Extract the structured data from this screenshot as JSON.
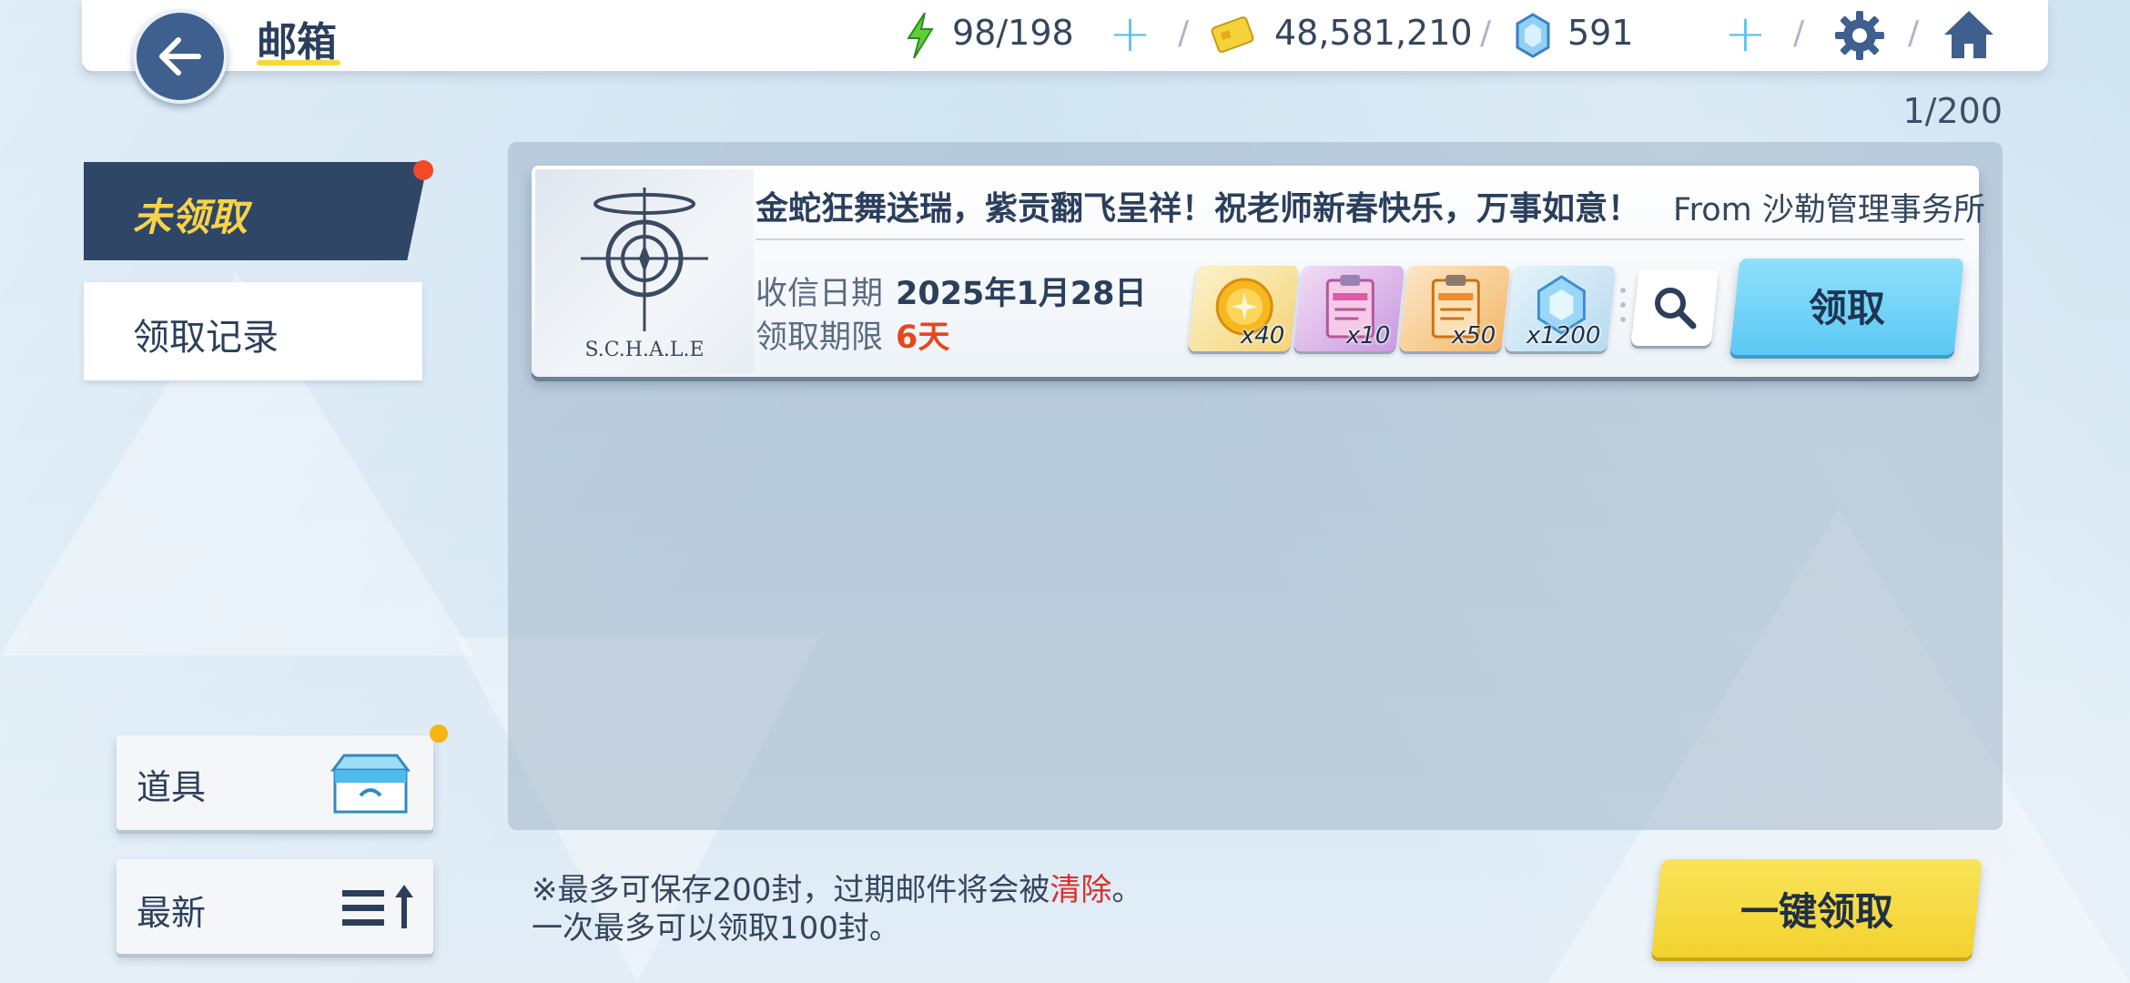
{
  "header": {
    "title": "邮箱",
    "stamina": "98/198",
    "credits": "48,581,210",
    "gems": "591",
    "stamina_add": "+",
    "gems_add": "+",
    "separators": [
      "/",
      "/",
      "/",
      "/",
      "/"
    ]
  },
  "page_counter": "1/200",
  "tabs": {
    "unclaimed": "未领取",
    "history": "领取记录"
  },
  "mail": {
    "logo_text": "S.C.H.A.L.E",
    "subject": "金蛇狂舞送瑞，紫贡翻飞呈祥！祝老师新春快乐，万事如意！",
    "from": "From 沙勒管理事务所",
    "received_label": "收信日期",
    "received_value": "2025年1月28日",
    "deadline_label": "领取期限",
    "deadline_value": "6天",
    "rewards": [
      {
        "icon": "gold-coin-icon",
        "qty": "x40"
      },
      {
        "icon": "pink-report-icon",
        "qty": "x10"
      },
      {
        "icon": "orange-report-icon",
        "qty": "x50"
      },
      {
        "icon": "blue-crystal-icon",
        "qty": "x1200"
      }
    ],
    "claim_label": "领取"
  },
  "bottom": {
    "items_label": "道具",
    "sort_label": "最新",
    "notice_line1_a": "※最多可保存200封，过期邮件将会被",
    "notice_line1_red": "清除",
    "notice_line1_b": "。",
    "notice_line2": "一次最多可以领取100封。",
    "claim_all_label": "一键领取"
  },
  "colors": {
    "accent_blue": "#5bc8f5",
    "accent_yellow": "#f2d22e",
    "navy": "#2f4667",
    "alert_red": "#e8461e"
  }
}
